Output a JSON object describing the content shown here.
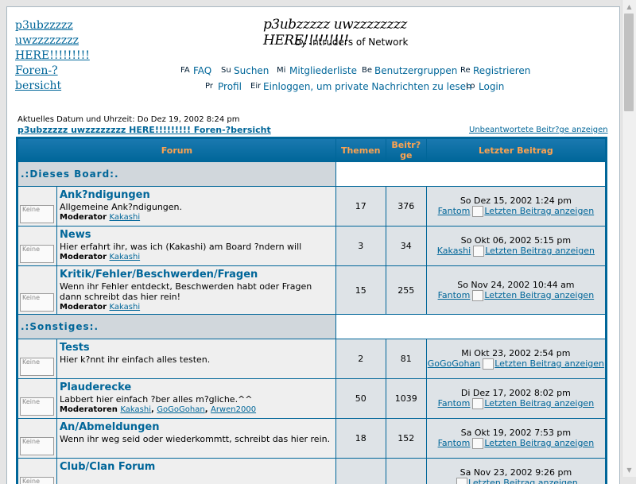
{
  "header": {
    "logo_alt": "p3ubzzzzz uwzzzzzzzz HERE!!!!!!!!! Foren-?bersicht",
    "site_title": "p3ubzzzzz uwzzzzzzzz HERE!!!!!!!!!",
    "site_desc": "by Intruders of Network"
  },
  "nav": [
    {
      "icon_text": "FA",
      "icon": "faq-icon",
      "label": "FAQ"
    },
    {
      "icon_text": "Su",
      "icon": "search-icon",
      "label": "Suchen"
    },
    {
      "icon_text": "Mi",
      "icon": "members-icon",
      "label": "Mitgliederliste"
    },
    {
      "icon_text": "Be",
      "icon": "groups-icon",
      "label": "Benutzergruppen"
    },
    {
      "icon_text": "Re",
      "icon": "register-icon",
      "label": "Registrieren"
    },
    {
      "icon_text": "Pr",
      "icon": "profile-icon",
      "label": "Profil"
    },
    {
      "icon_text": "Ein",
      "icon": "messages-icon",
      "label": "Einloggen, um private Nachrichten zu lesen"
    },
    {
      "icon_text": "Lo",
      "icon": "login-icon",
      "label": "Login"
    }
  ],
  "info": {
    "date_line": "Aktuelles Datum und Uhrzeit: Do Dez 19, 2002 8:24 pm",
    "breadcrumb": "p3ubzzzzz uwzzzzzzzz HERE!!!!!!!!! Foren-?bersicht",
    "unanswered": "Unbeantwortete Beitr?ge anzeigen"
  },
  "table": {
    "headers": {
      "forum": "Forum",
      "topics": "Themen",
      "posts": "Beitr?ge",
      "last_post": "Letzter Beitrag"
    },
    "view_post_alt": "Letzten Beitrag anzeigen",
    "folder_alt": "Keine",
    "categories": [
      {
        "name": ".:Dieses Board:.",
        "forums": [
          {
            "name": "Ank?ndigungen",
            "desc": "Allgemeine Ank?ndigungen.",
            "mod_label": "Moderator",
            "mods": [
              "Kakashi"
            ],
            "topics": "17",
            "posts": "376",
            "last_date": "So Dez 15, 2002 1:24 pm",
            "last_user": "Fantom"
          },
          {
            "name": "News",
            "desc": "Hier erfahrt ihr, was ich (Kakashi) am Board ?ndern will",
            "mod_label": "Moderator",
            "mods": [
              "Kakashi"
            ],
            "topics": "3",
            "posts": "34",
            "last_date": "So Okt 06, 2002 5:15 pm",
            "last_user": "Kakashi"
          },
          {
            "name": "Kritik/Fehler/Beschwerden/Fragen",
            "desc": "Wenn ihr Fehler entdeckt, Beschwerden habt oder Fragen dann schreibt das hier rein!",
            "mod_label": "Moderator",
            "mods": [
              "Kakashi"
            ],
            "topics": "15",
            "posts": "255",
            "last_date": "So Nov 24, 2002 10:44 am",
            "last_user": "Fantom"
          }
        ]
      },
      {
        "name": ".:Sonstiges:.",
        "forums": [
          {
            "name": "Tests",
            "desc": "Hier k?nnt ihr einfach alles testen.",
            "mod_label": "",
            "mods": [],
            "topics": "2",
            "posts": "81",
            "last_date": "Mi Okt 23, 2002 2:54 pm",
            "last_user": "GoGoGohan"
          },
          {
            "name": "Plauderecke",
            "desc": "Labbert hier einfach ?ber alles m?gliche.^^",
            "mod_label": "Moderatoren",
            "mods": [
              "Kakashi",
              "GoGoGohan",
              "Arwen2000"
            ],
            "topics": "50",
            "posts": "1039",
            "last_date": "Di Dez 17, 2002 8:02 pm",
            "last_user": "Fantom"
          },
          {
            "name": "An/Abmeldungen",
            "desc": "Wenn ihr weg seid oder wiederkommtt, schreibt das hier rein.",
            "mod_label": "",
            "mods": [],
            "topics": "18",
            "posts": "152",
            "last_date": "Sa Okt 19, 2002 7:53 pm",
            "last_user": "Fantom"
          },
          {
            "name": "Club/Clan Forum",
            "desc": "",
            "mod_label": "",
            "mods": [],
            "topics": "",
            "posts": "",
            "last_date": "Sa Nov 23, 2002 9:26 pm",
            "last_user": ""
          }
        ]
      }
    ]
  },
  "colors": {
    "header_bg": "#006699",
    "header_text": "#ffa34f",
    "link": "#006699",
    "row1": "#efefef",
    "row2": "#dee3e7",
    "row3": "#d1d7dc"
  }
}
